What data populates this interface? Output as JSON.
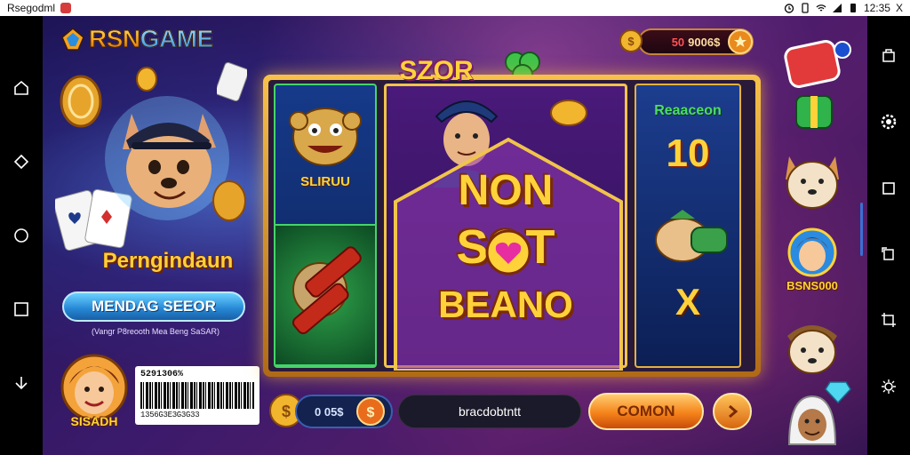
{
  "status_bar": {
    "app_name": "Rsegodml",
    "time": "12:35",
    "suffix": "X"
  },
  "header": {
    "logo_text_a": "RSN",
    "logo_text_b": "GAME",
    "balance_prefix": "50",
    "balance_value": "9006$"
  },
  "slot": {
    "banner": "SZOR",
    "reel1_label": "SLIRUU",
    "center_line1": "NON",
    "center_line2": "SOT",
    "center_line3": "BEANO",
    "reel3_title": "Reaaceon",
    "reel3_number": "10",
    "reel3_multiplier": "X"
  },
  "promo": {
    "title": "Perngindaun",
    "button_label": "MENDAG SEEOR",
    "subtitle": "(Vangr P8reooth Mea Beng SaSAR)"
  },
  "user": {
    "label": "SISADH",
    "barcode_top": "5291306%",
    "barcode_number": "1356G3E3G3G33"
  },
  "bottom_bar": {
    "bet_value": "0 05$",
    "input_text": "bracdobtntt",
    "spin_label": "COMON"
  },
  "right_column": {
    "avatar_label": "BSNS000"
  },
  "colors": {
    "accent_gold": "#ffd23a",
    "accent_orange": "#f5831a",
    "accent_blue": "#2486d4",
    "bg": "#3b1a6b"
  },
  "icons": [
    "home-icon",
    "back-icon",
    "circle-icon",
    "square-icon",
    "download-icon",
    "screenshot-icon",
    "settings-icon",
    "overview-icon",
    "rotate-icon",
    "crop-icon",
    "brightness-icon"
  ]
}
